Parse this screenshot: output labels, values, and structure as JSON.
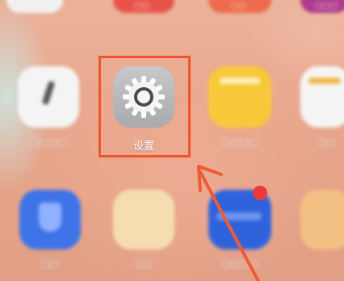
{
  "settings_app": {
    "label": "设置",
    "icon": "gear-icon"
  },
  "blurred_icons": [
    {
      "name": "clock-icon",
      "color": "#f4f4f4"
    },
    {
      "name": "notes-icon",
      "color": "#f7c93a"
    },
    {
      "name": "calendar-icon",
      "color": "#f5f5f5"
    },
    {
      "name": "security-icon",
      "color": "#3f74e8"
    },
    {
      "name": "gallery-icon",
      "color": "#f5ddb0"
    },
    {
      "name": "files-icon",
      "color": "#2f63dc"
    },
    {
      "name": "photos-icon",
      "color": "#f3c084"
    }
  ],
  "annotation": {
    "box_color": "#f0552a",
    "arrow_color": "#f05b34"
  }
}
